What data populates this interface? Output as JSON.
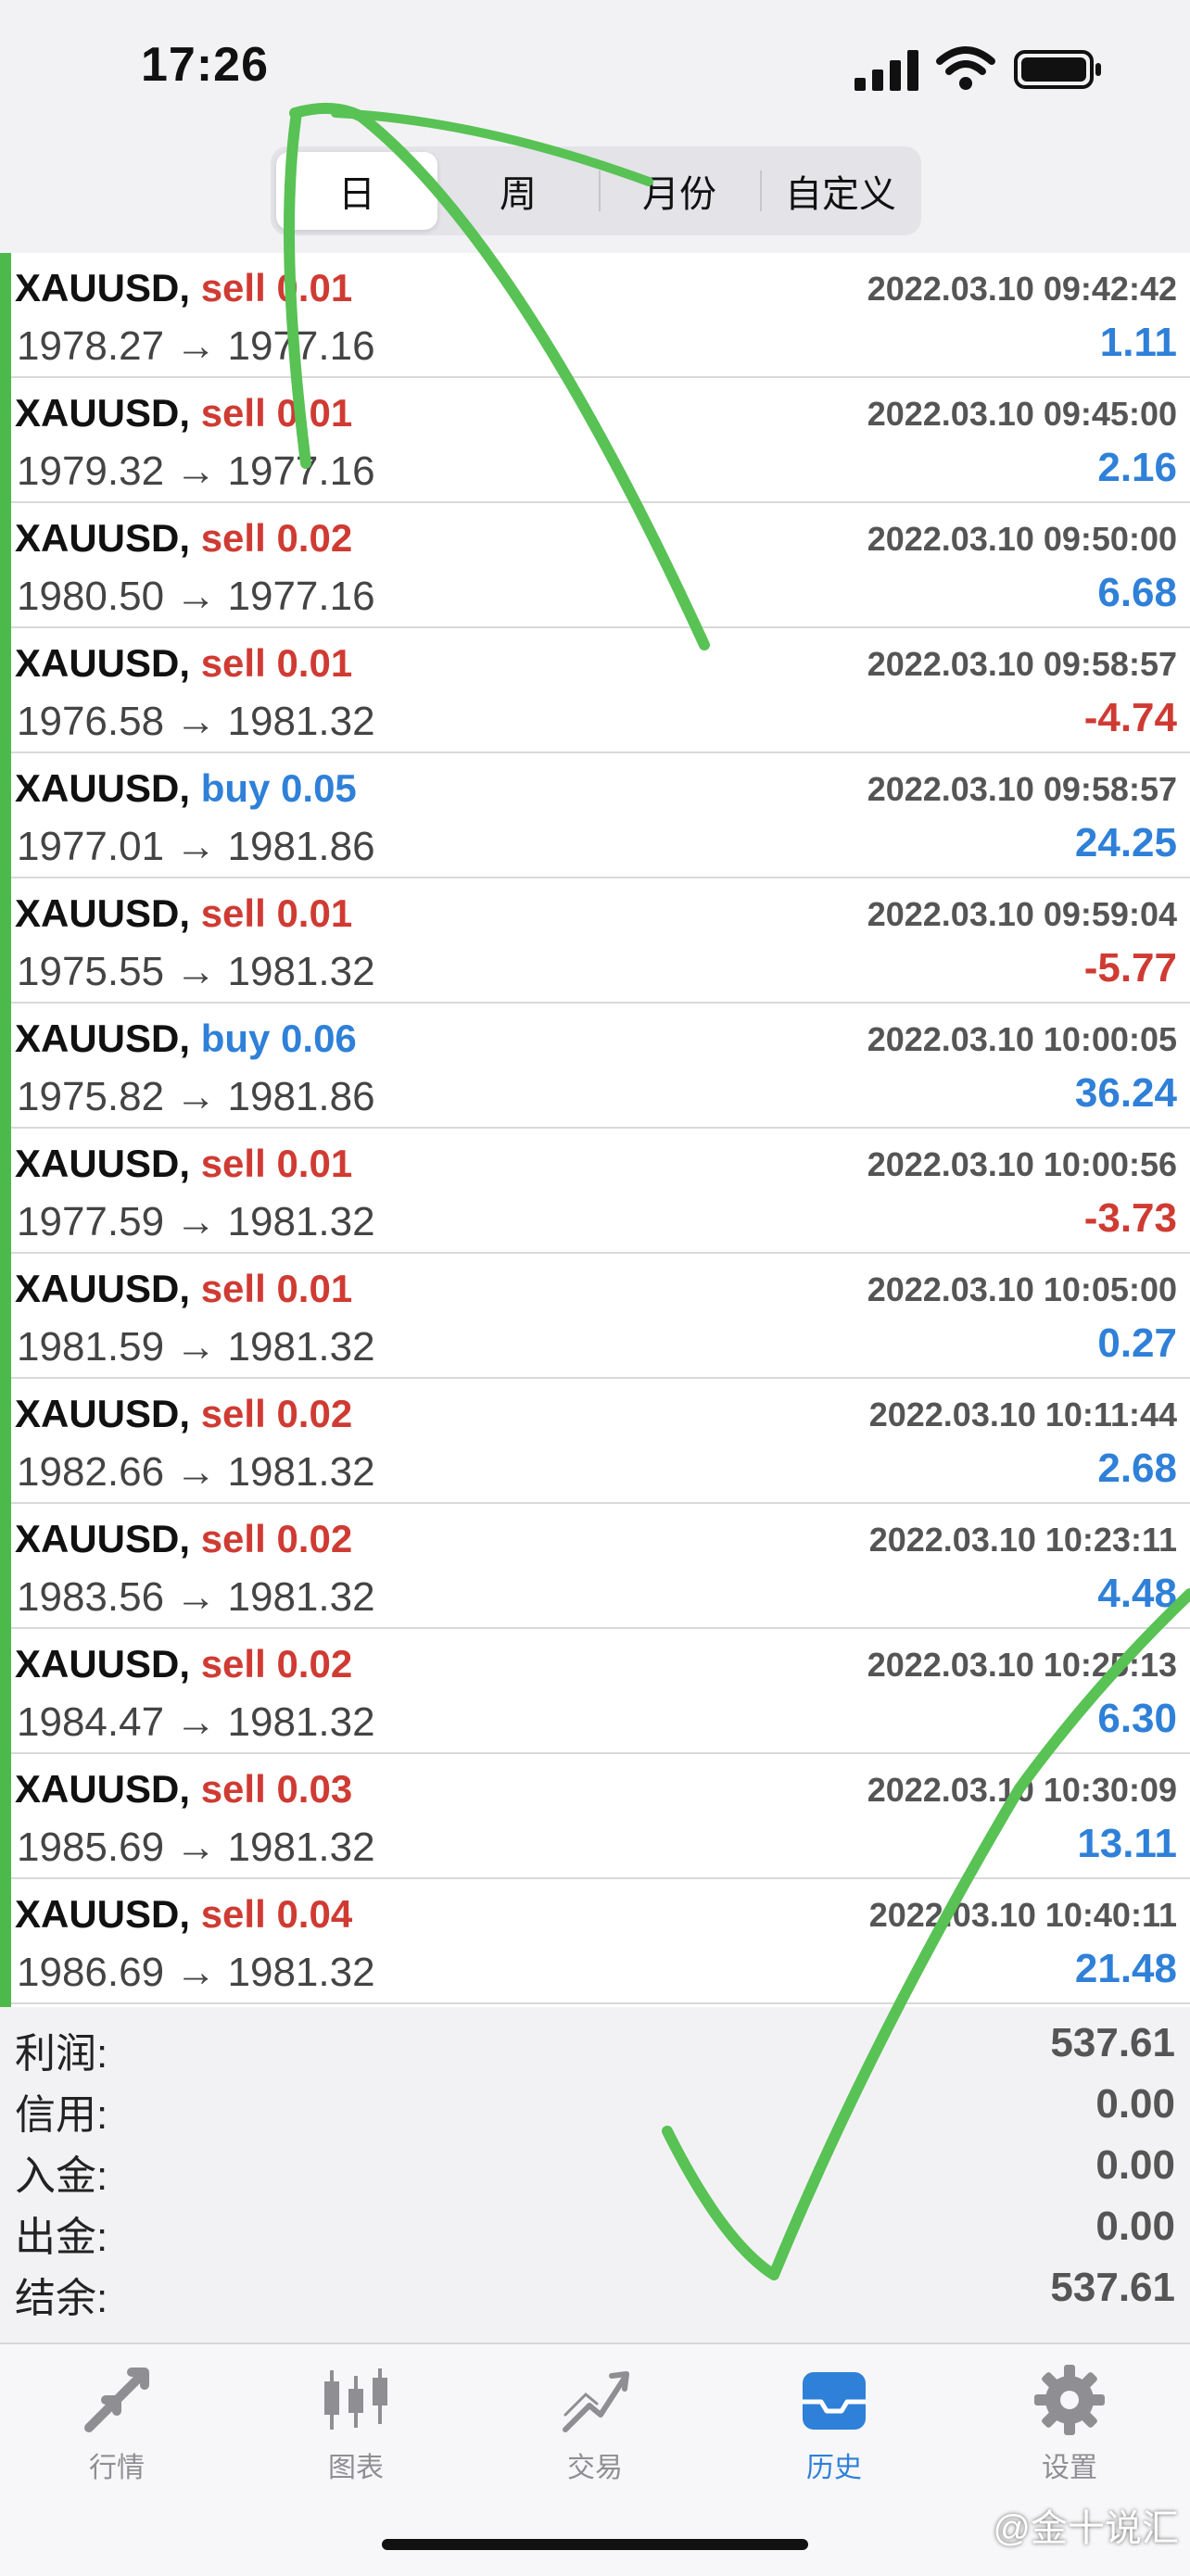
{
  "status_bar": {
    "time": "17:26"
  },
  "period_tabs": [
    {
      "label": "日",
      "active": true
    },
    {
      "label": "周",
      "active": false
    },
    {
      "label": "月份",
      "active": false
    },
    {
      "label": "自定义",
      "active": false
    }
  ],
  "trades": [
    {
      "symbol": "XAUUSD,",
      "side": "sell",
      "volume": "0.01",
      "prices": "1978.27 → 1977.16",
      "time": "2022.03.10 09:42:42",
      "profit": "1.11"
    },
    {
      "symbol": "XAUUSD,",
      "side": "sell",
      "volume": "0.01",
      "prices": "1979.32 → 1977.16",
      "time": "2022.03.10 09:45:00",
      "profit": "2.16"
    },
    {
      "symbol": "XAUUSD,",
      "side": "sell",
      "volume": "0.02",
      "prices": "1980.50 → 1977.16",
      "time": "2022.03.10 09:50:00",
      "profit": "6.68"
    },
    {
      "symbol": "XAUUSD,",
      "side": "sell",
      "volume": "0.01",
      "prices": "1976.58 → 1981.32",
      "time": "2022.03.10 09:58:57",
      "profit": "-4.74"
    },
    {
      "symbol": "XAUUSD,",
      "side": "buy",
      "volume": "0.05",
      "prices": "1977.01 → 1981.86",
      "time": "2022.03.10 09:58:57",
      "profit": "24.25"
    },
    {
      "symbol": "XAUUSD,",
      "side": "sell",
      "volume": "0.01",
      "prices": "1975.55 → 1981.32",
      "time": "2022.03.10 09:59:04",
      "profit": "-5.77"
    },
    {
      "symbol": "XAUUSD,",
      "side": "buy",
      "volume": "0.06",
      "prices": "1975.82 → 1981.86",
      "time": "2022.03.10 10:00:05",
      "profit": "36.24"
    },
    {
      "symbol": "XAUUSD,",
      "side": "sell",
      "volume": "0.01",
      "prices": "1977.59 → 1981.32",
      "time": "2022.03.10 10:00:56",
      "profit": "-3.73"
    },
    {
      "symbol": "XAUUSD,",
      "side": "sell",
      "volume": "0.01",
      "prices": "1981.59 → 1981.32",
      "time": "2022.03.10 10:05:00",
      "profit": "0.27"
    },
    {
      "symbol": "XAUUSD,",
      "side": "sell",
      "volume": "0.02",
      "prices": "1982.66 → 1981.32",
      "time": "2022.03.10 10:11:44",
      "profit": "2.68"
    },
    {
      "symbol": "XAUUSD,",
      "side": "sell",
      "volume": "0.02",
      "prices": "1983.56 → 1981.32",
      "time": "2022.03.10 10:23:11",
      "profit": "4.48"
    },
    {
      "symbol": "XAUUSD,",
      "side": "sell",
      "volume": "0.02",
      "prices": "1984.47 → 1981.32",
      "time": "2022.03.10 10:25:13",
      "profit": "6.30"
    },
    {
      "symbol": "XAUUSD,",
      "side": "sell",
      "volume": "0.03",
      "prices": "1985.69 → 1981.32",
      "time": "2022.03.10 10:30:09",
      "profit": "13.11"
    },
    {
      "symbol": "XAUUSD,",
      "side": "sell",
      "volume": "0.04",
      "prices": "1986.69 → 1981.32",
      "time": "2022.03.10 10:40:11",
      "profit": "21.48"
    }
  ],
  "summary": [
    {
      "label": "利润:",
      "value": "537.61"
    },
    {
      "label": "信用:",
      "value": "0.00"
    },
    {
      "label": "入金:",
      "value": "0.00"
    },
    {
      "label": "出金:",
      "value": "0.00"
    },
    {
      "label": "结余:",
      "value": "537.61"
    }
  ],
  "tab_bar": [
    {
      "label": "行情",
      "icon": "quotes-arrows-icon",
      "active": false
    },
    {
      "label": "图表",
      "icon": "candlestick-chart-icon",
      "active": false
    },
    {
      "label": "交易",
      "icon": "trade-trend-icon",
      "active": false
    },
    {
      "label": "历史",
      "icon": "history-inbox-icon",
      "active": true
    },
    {
      "label": "设置",
      "icon": "gear-icon",
      "active": false
    }
  ],
  "watermark": "@金十说汇",
  "colors": {
    "sell": "#cf3b33",
    "buy": "#2f80d8",
    "accent_green": "#4cba4a",
    "active_tab": "#2f80d8"
  }
}
